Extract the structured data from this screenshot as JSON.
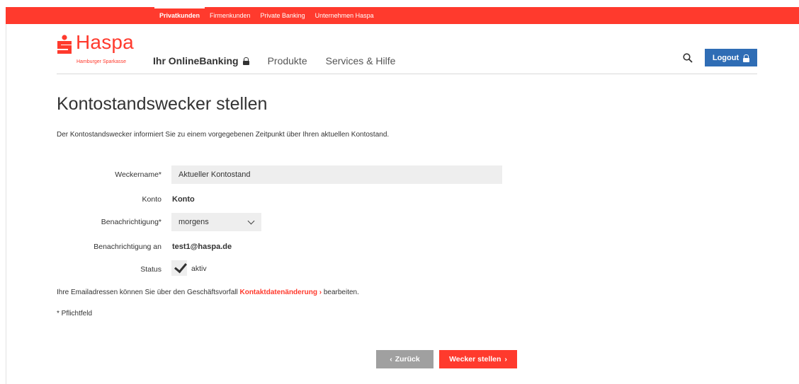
{
  "colors": {
    "brand_red": "#ff3a2d",
    "logout_blue": "#2f6db5",
    "back_gray": "#a0a0a0",
    "field_bg": "#eeeeee"
  },
  "topnav": {
    "items": [
      "Privatkunden",
      "Firmenkunden",
      "Private Banking",
      "Unternehmen Haspa"
    ],
    "active": "Privatkunden"
  },
  "logo": {
    "name": "Haspa",
    "subtitle": "Hamburger Sparkasse"
  },
  "mainnav": {
    "online_banking": "Ihr OnlineBanking",
    "items": [
      "Produkte",
      "Services & Hilfe"
    ]
  },
  "header": {
    "search_icon": "search-icon",
    "logout_label": "Logout"
  },
  "page": {
    "title": "Kontostandswecker stellen",
    "intro": "Der Kontostandswecker informiert Sie zu einem vorgegebenen Zeitpunkt über Ihren aktuellen Kontostand."
  },
  "form": {
    "weckername_label": "Weckername*",
    "weckername_value": "Aktueller Kontostand",
    "konto_label": "Konto",
    "konto_value": "Konto",
    "benachrichtigung_label": "Benachrichtigung*",
    "benachrichtigung_selected": "morgens",
    "benachrichtigung_an_label": "Benachrichtigung an",
    "benachrichtigung_an_value": "test1@haspa.de",
    "status_label": "Status",
    "status_value": "aktiv",
    "status_checked": true
  },
  "info": {
    "prefix": "Ihre Emailadressen können Sie über den Geschäftsvorfall",
    "link": "Kontaktdatenänderung",
    "suffix": "bearbeiten.",
    "required_note": "* Pflichtfeld"
  },
  "buttons": {
    "back": "Zurück",
    "submit": "Wecker stellen"
  }
}
